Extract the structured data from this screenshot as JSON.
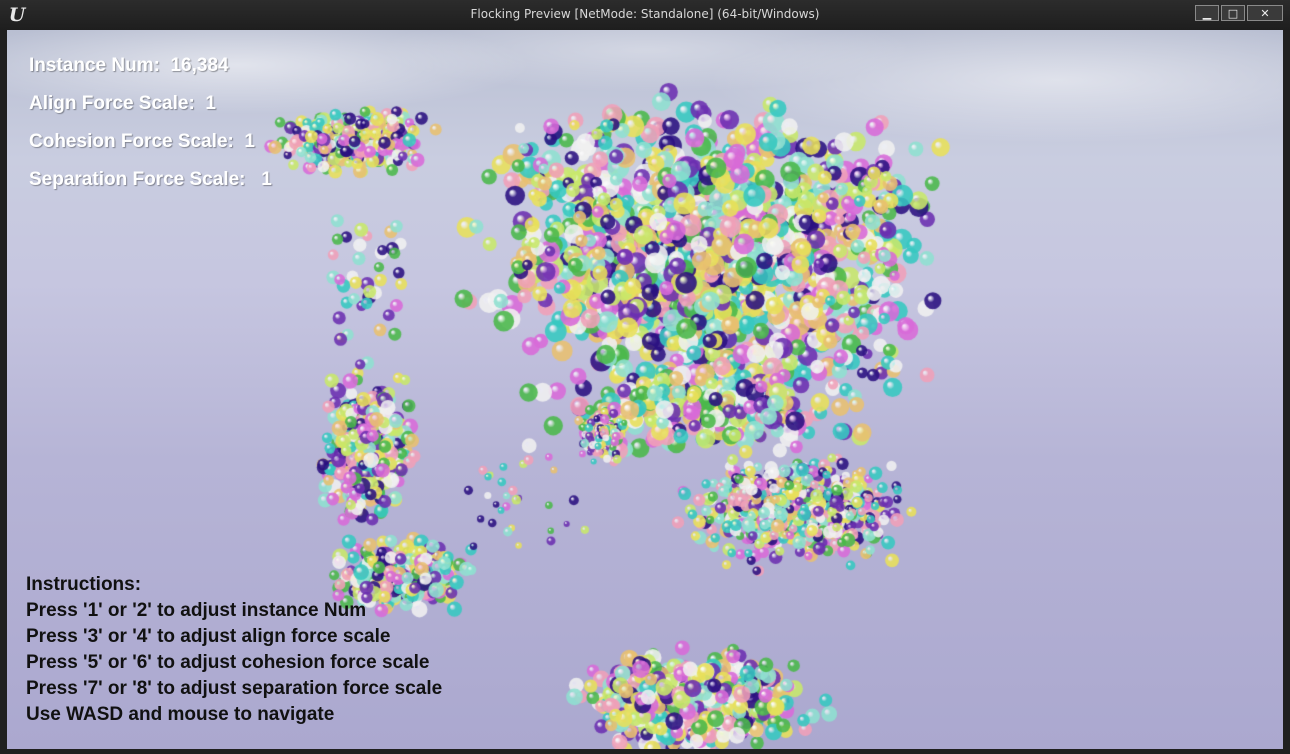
{
  "window": {
    "title": "Flocking Preview [NetMode: Standalone] (64-bit/Windows)",
    "logo_text": "U",
    "buttons": {
      "minimize": "▁",
      "maximize": "□",
      "close": "✕"
    }
  },
  "hud": {
    "stats": [
      "Instance Num:  16,384",
      "Align Force Scale:  1",
      "Cohesion Force Scale:  1",
      "Separation Force Scale:   1"
    ],
    "instructions": [
      "Instructions:",
      "Press '1' or '2' to adjust instance Num",
      "Press '3' or '4' to adjust align force scale",
      "Press '5' or '6' to adjust cohesion force scale",
      "Press '7' or '8' to adjust separation force scale",
      "Use WASD and mouse to navigate"
    ]
  },
  "colors": {
    "boid_palette": [
      "#e8e05a",
      "#f0a0b8",
      "#36c8c0",
      "#4ab84a",
      "#6b2fb0",
      "#d86ad8",
      "#f0f0f0",
      "#8fe0d0",
      "#e8c070",
      "#c8e86a",
      "#2a1080"
    ],
    "stat_text": "#ffffff",
    "instruction_text": "#111111"
  }
}
